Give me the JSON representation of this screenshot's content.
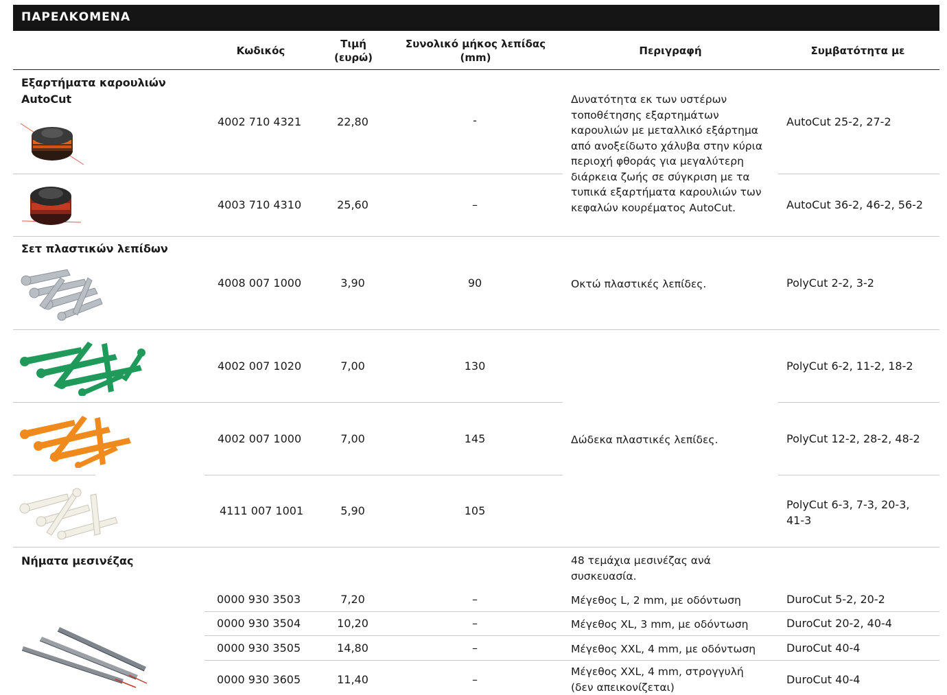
{
  "title": "ΠΑΡΕΛΚΟΜΕΝΑ",
  "headers": {
    "code": "Κωδικός",
    "price_l1": "Τιμή",
    "price_l2": "(ευρώ)",
    "length_l1": "Συνολικό μήκος λεπίδας",
    "length_l2": "(mm)",
    "description": "Περιγραφή",
    "compat": "Συμβατότητα με"
  },
  "groups": {
    "autocut_l1": "Εξαρτήματα καρουλιών",
    "autocut_l2": "AutoCut",
    "plastic": "Σετ πλαστικών λεπίδων",
    "durocut": "Νήματα μεσινέζας"
  },
  "rows": [
    {
      "code": "4002 710 4321",
      "price": "22,80",
      "length": "-",
      "compat": "AutoCut 25-2, 27-2"
    },
    {
      "code": "4003 710 4310",
      "price": "25,60",
      "length": "–",
      "compat": "AutoCut 36-2, 46-2, 56-2"
    },
    {
      "code": "4008 007 1000",
      "price": "3,90",
      "length": "90",
      "compat": "PolyCut 2-2, 3-2"
    },
    {
      "code": "4002 007 1020",
      "price": "7,00",
      "length": "130",
      "compat": "PolyCut 6-2, 11-2, 18-2"
    },
    {
      "code": "4002 007 1000",
      "price": "7,00",
      "length": "145",
      "compat": "PolyCut 12-2, 28-2, 48-2"
    },
    {
      "code": "4111 007 1001",
      "price": "5,90",
      "length": "105",
      "compat_l1": "PolyCut 6-3, 7-3, 20-3,",
      "compat_l2": "41-3"
    },
    {
      "code": "0000 930 3503",
      "price": "7,20",
      "length": "–",
      "desc": "Μέγεθος L, 2 mm, με οδόντωση",
      "compat": "DuroCut 5-2, 20-2"
    },
    {
      "code": "0000 930 3504",
      "price": "10,20",
      "length": "–",
      "desc": "Μέγεθος XL, 3 mm, με οδόντωση",
      "compat": "DuroCut 20-2, 40-4"
    },
    {
      "code": "0000 930 3505",
      "price": "14,80",
      "length": "–",
      "desc": "Μέγεθος XXL, 4 mm, με οδόντωση",
      "compat": "DuroCut 40-4"
    },
    {
      "code": "0000 930 3605",
      "price": "11,40",
      "length": "–",
      "desc_l1": "Μέγεθος XXL, 4 mm, στρογγυλή",
      "desc_l2": "(δεν απεικονίζεται)",
      "compat": "DuroCut 40-4"
    }
  ],
  "descriptions": {
    "autocut": [
      "Δυνατότητα εκ των υστέρων",
      "τοποθέτησης εξαρτημάτων",
      "καρουλιών με μεταλλικό εξάρτημα",
      "από ανοξείδωτο χάλυβα στην κύρια",
      "περιοχή φθοράς για μεγαλύτερη",
      "διάρκεια ζωής σε σύγκριση με τα",
      "τυπικά εξαρτήματα καρουλιών των",
      "κεφαλών κουρέματος AutoCut."
    ],
    "eight_blades": "Οκτώ πλαστικές λεπίδες.",
    "twelve_blades": "Δώδεκα πλαστικές λεπίδες.",
    "durocut_l1": "48 τεμάχια μεσινέζας ανά",
    "durocut_l2": "συσκευασία."
  },
  "images": {
    "spool1": "autocut-spool-image",
    "spool2": "autocut-spool-image",
    "blades_grey": "grey-plastic-blades-image",
    "blades_green": "green-plastic-blades-image",
    "blades_orange": "orange-plastic-blades-image",
    "blades_white": "white-plastic-blades-image",
    "lines": "durocut-lines-image"
  },
  "colors": {
    "title_bg": "#151515",
    "blade_green": "#1f9a5a",
    "blade_orange": "#f08a1c",
    "blade_grey": "#b9bec4",
    "blade_white": "#f1efe6"
  }
}
